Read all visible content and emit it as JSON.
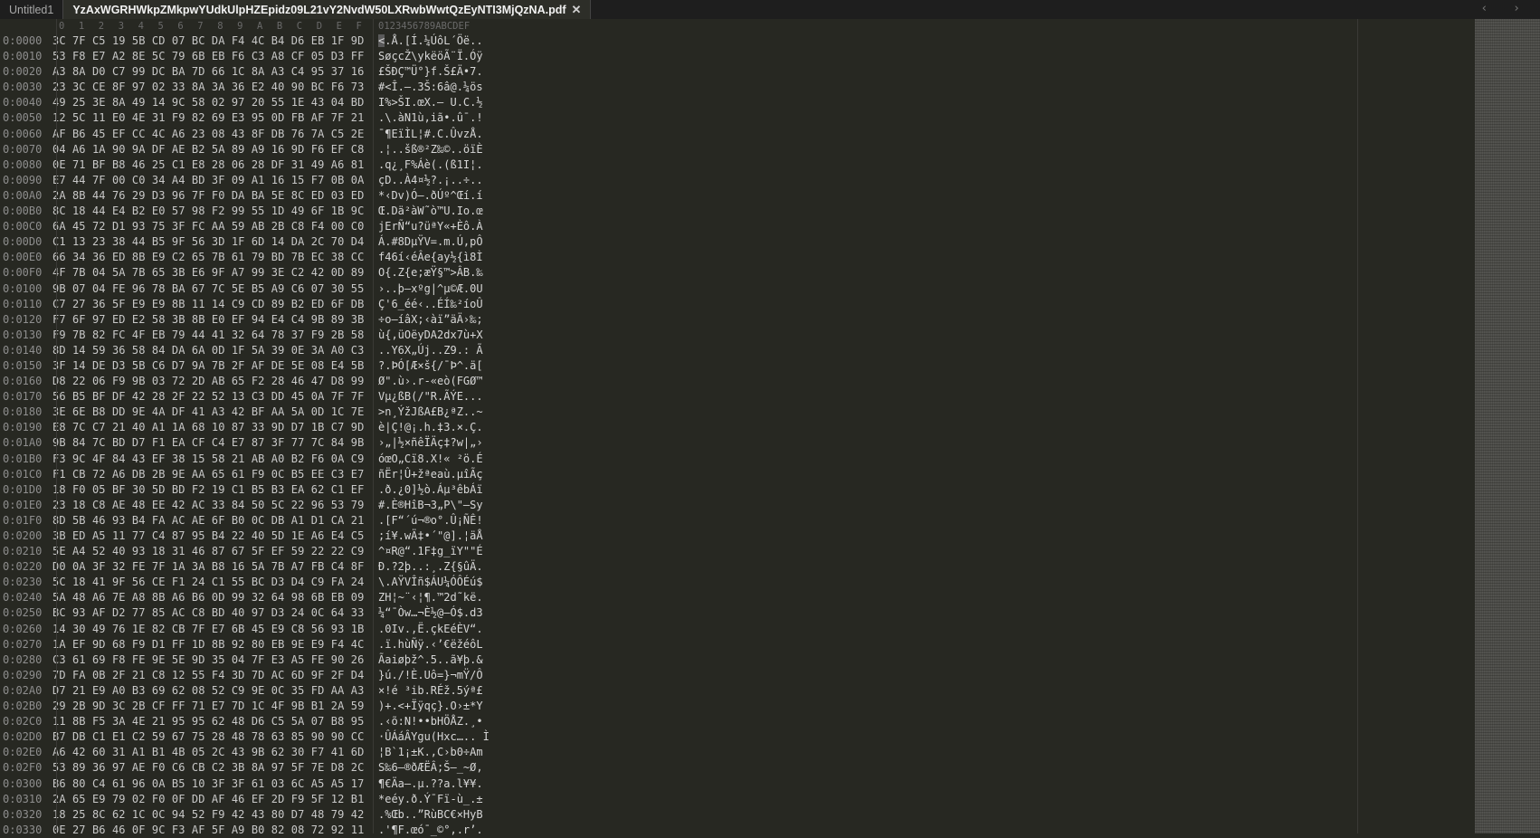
{
  "tabs": [
    {
      "label": "Untitled1",
      "active": false
    },
    {
      "label": "YzAxWGRHWkpZMkpwYUdkUlpHZEpidz09L21vY2NvdW50LXRwbWwtQzEyNTI3MjQzNA.pdf",
      "active": true
    }
  ],
  "tab_close_glyph": "✕",
  "tab_nav_glyphs": "‹ ›",
  "column_header": {
    "hex": [
      "0",
      "1",
      "2",
      "3",
      "4",
      "5",
      "6",
      "7",
      "8",
      "9",
      "A",
      "B",
      "C",
      "D",
      "E",
      "F"
    ],
    "ascii": "0123456789ABCDEF"
  },
  "rows": [
    {
      "addr": "0:0000",
      "hex": "3C 7F C5 19 5B CD 07 BC DA F4 4C B4 D6 EB 1F 9D",
      "ascii": "<.Å.[Í.¼ÚôL´Öë.."
    },
    {
      "addr": "0:0010",
      "hex": "53 F8 E7 A2 8E 5C 79 6B EB F6 C3 A8 CF 05 D3 FF",
      "ascii": "SøçcŽ\\ykëöÃ¨Ï.Óÿ"
    },
    {
      "addr": "0:0020",
      "hex": "A3 8A D0 C7 99 DC BA 7D 66 1C 8A A3 C4 95 37 16",
      "ascii": "£ŠÐÇ™Ü°}f.Š£Ä•7."
    },
    {
      "addr": "0:0030",
      "hex": "23 3C CE 8F 97 02 33 8A 3A 36 E2 40 90 BC F6 73",
      "ascii": "#<Î.—.3Š:6â@.¼ös"
    },
    {
      "addr": "0:0040",
      "hex": "49 25 3E 8A 49 14 9C 58 02 97 20 55 1E 43 04 BD",
      "ascii": "I%>ŠI.œX.— U.C.½"
    },
    {
      "addr": "0:0050",
      "hex": "12 5C 11 E0 4E 31 F9 82 69 E3 95 0D FB AF 7F 21",
      "ascii": ".\\.àN1ù‚iã•.û¯.!"
    },
    {
      "addr": "0:0060",
      "hex": "AF B6 45 EF CC 4C A6 23 08 43 8F DB 76 7A C5 2E",
      "ascii": "¯¶EïÌL¦#.C.ÛvzÅ."
    },
    {
      "addr": "0:0070",
      "hex": "04 A6 1A 90 9A DF AE B2 5A 89 A9 16 9D F6 EF C8",
      "ascii": ".¦..šß®²Z‰©..öïÈ"
    },
    {
      "addr": "0:0080",
      "hex": "0E 71 BF B8 46 25 C1 E8 28 06 28 DF 31 49 A6 81",
      "ascii": ".q¿¸F%Áè(.(ß1I¦."
    },
    {
      "addr": "0:0090",
      "hex": "E7 44 7F 00 C0 34 A4 BD 3F 09 A1 16 15 F7 0B 0A",
      "ascii": "çD..À4¤½?.¡..÷.."
    },
    {
      "addr": "0:00A0",
      "hex": "2A 8B 44 76 29 D3 96 7F F0 DA BA 5E 8C ED 03 ED",
      "ascii": "*‹Dv)Ó–.ðÚº^Œí.í"
    },
    {
      "addr": "0:00B0",
      "hex": "8C 18 44 E4 B2 E0 57 98 F2 99 55 1D 49 6F 1B 9C",
      "ascii": "Œ.Dä²àW˜ò™U.Io.œ"
    },
    {
      "addr": "0:00C0",
      "hex": "6A 45 72 D1 93 75 3F FC AA 59 AB 2B C8 F4 00 C0",
      "ascii": "jErÑ“u?üªY«+Èô.À"
    },
    {
      "addr": "0:00D0",
      "hex": "C1 13 23 38 44 B5 9F 56 3D 1F 6D 14 DA 2C 70 D4",
      "ascii": "Á.#8DµŸV=.m.Ú,pÔ"
    },
    {
      "addr": "0:00E0",
      "hex": "66 34 36 ED 8B E9 C2 65 7B 61 79 BD 7B EC 38 CC",
      "ascii": "f46í‹éÂe{ay½{ì8Ì"
    },
    {
      "addr": "0:00F0",
      "hex": "4F 7B 04 5A 7B 65 3B E6 9F A7 99 3E C2 42 0D 89",
      "ascii": "O{.Z{e;æŸ§™>ÂB.‰"
    },
    {
      "addr": "0:0100",
      "hex": "9B 07 04 FE 96 78 BA 67 7C 5E B5 A9 C6 07 30 55",
      "ascii": "›..þ–xºg|^µ©Æ.0U"
    },
    {
      "addr": "0:0110",
      "hex": "C7 27 36 5F E9 E9 8B 11 14 C9 CD 89 B2 ED 6F DB",
      "ascii": "Ç'6_éé‹..ÉÍ‰²íoÛ"
    },
    {
      "addr": "0:0120",
      "hex": "F7 6F 97 ED E2 58 3B 8B E0 EF 94 E4 C4 9B 89 3B",
      "ascii": "÷o—íâX;‹àï”äÄ›‰;"
    },
    {
      "addr": "0:0130",
      "hex": "F9 7B 82 FC 4F EB 79 44 41 32 64 78 37 F9 2B 58",
      "ascii": "ù{‚üOëyDA2dx7ù+X"
    },
    {
      "addr": "0:0140",
      "hex": "8D 14 59 36 58 84 DA 6A 0D 1F 5A 39 0E 3A A0 C3",
      "ascii": "..Y6X„Új..Z9.: Ã"
    },
    {
      "addr": "0:0150",
      "hex": "3F 14 DE D3 5B C6 D7 9A 7B 2F AF DE 5E 08 E4 5B",
      "ascii": "?.ÞÓ[Æ×š{/¯Þ^.ä["
    },
    {
      "addr": "0:0160",
      "hex": "D8 22 06 F9 9B 03 72 2D AB 65 F2 28 46 47 D8 99",
      "ascii": "Ø\".ù›.r-«eò(FGØ™"
    },
    {
      "addr": "0:0170",
      "hex": "56 B5 BF DF 42 28 2F 22 52 13 C3 DD 45 0A 7F 7F",
      "ascii": "Vµ¿ßB(/\"R.ÃÝE..."
    },
    {
      "addr": "0:0180",
      "hex": "3E 6E B8 DD 9E 4A DF 41 A3 42 BF AA 5A 0D 1C 7E",
      "ascii": ">n¸ÝžJßA£B¿ªZ..~"
    },
    {
      "addr": "0:0190",
      "hex": "E8 7C C7 21 40 A1 1A 68 10 87 33 9D D7 1B C7 9D",
      "ascii": "è|Ç!@¡.h.‡3.×.Ç."
    },
    {
      "addr": "0:01A0",
      "hex": "9B 84 7C BD D7 F1 EA CF C4 E7 87 3F 77 7C 84 9B",
      "ascii": "›„|½×ñêÏÄç‡?w|„›"
    },
    {
      "addr": "0:01B0",
      "hex": "F3 9C 4F 84 43 EF 38 15 58 21 AB A0 B2 F6 0A C9",
      "ascii": "óœO„Cï8.X!« ²ö.É"
    },
    {
      "addr": "0:01C0",
      "hex": "F1 CB 72 A6 DB 2B 9E AA 65 61 F9 0C B5 EE C3 E7",
      "ascii": "ñËr¦Û+žªeaù.µîÃç"
    },
    {
      "addr": "0:01D0",
      "hex": "18 F0 05 BF 30 5D BD F2 19 C1 B5 B3 EA 62 C1 EF",
      "ascii": ".ð.¿0]½ò.Áµ³êbÁï"
    },
    {
      "addr": "0:01E0",
      "hex": "23 18 C8 AE 48 EE 42 AC 33 84 50 5C 22 96 53 79",
      "ascii": "#.È®HîB¬3„P\\\"–Sy"
    },
    {
      "addr": "0:01F0",
      "hex": "8D 5B 46 93 B4 FA AC AE 6F B0 0C DB A1 D1 CA 21",
      "ascii": ".[F“´ú¬®o°.Û¡ÑÊ!"
    },
    {
      "addr": "0:0200",
      "hex": "3B ED A5 11 77 C4 87 95 B4 22 40 5D 1E A6 E4 C5",
      "ascii": ";í¥.wÄ‡•´\"@].¦äÅ"
    },
    {
      "addr": "0:0210",
      "hex": "5E A4 52 40 93 18 31 46 87 67 5F EF 59 22 22 C9",
      "ascii": "^¤R@“.1F‡g_ïY\"\"É"
    },
    {
      "addr": "0:0220",
      "hex": "D0 0A 3F 32 FE 7F 1A 3A B8 16 5A 7B A7 FB C4 8F",
      "ascii": "Ð.?2þ..:¸.Z{§ûÄ."
    },
    {
      "addr": "0:0230",
      "hex": "5C 18 41 9F 56 CE F1 24 C1 55 BC D3 D4 C9 FA 24",
      "ascii": "\\.AŸVÎñ$ÁU¼ÓÔÉú$"
    },
    {
      "addr": "0:0240",
      "hex": "5A 48 A6 7E A8 8B A6 B6 0D 99 32 64 98 6B EB 09",
      "ascii": "ZH¦~¨‹¦¶.™2d˜kë."
    },
    {
      "addr": "0:0250",
      "hex": "BC 93 AF D2 77 85 AC C8 BD 40 97 D3 24 0C 64 33",
      "ascii": "¼“¯Òw…¬È½@—Ó$.d3"
    },
    {
      "addr": "0:0260",
      "hex": "14 30 49 76 1E 82 CB 7F E7 6B 45 E9 C8 56 93 1B",
      "ascii": ".0Iv.‚Ë.çkEéÈV“."
    },
    {
      "addr": "0:0270",
      "hex": "1A EF 9D 68 F9 D1 FF 1D 8B 92 80 EB 9E E9 F4 4C",
      "ascii": ".ï.hùÑÿ.‹’€ëžéôL"
    },
    {
      "addr": "0:0280",
      "hex": "C3 61 69 F8 FE 9E 5E 9D 35 04 7F E3 A5 FE 90 26",
      "ascii": "Ãaiøþž^.5..ã¥þ.&"
    },
    {
      "addr": "0:0290",
      "hex": "7D FA 0B 2F 21 C8 12 55 F4 3D 7D AC 6D 9F 2F D4",
      "ascii": "}ú./!È.Uô=}¬mŸ/Ô"
    },
    {
      "addr": "0:02A0",
      "hex": "D7 21 E9 A0 B3 69 62 08 52 C9 9E 0C 35 FD AA A3",
      "ascii": "×!é ³ib.RÉž.5ýª£"
    },
    {
      "addr": "0:02B0",
      "hex": "29 2B 9D 3C 2B CF FF 71 E7 7D 1C 4F 9B B1 2A 59",
      "ascii": ")+.<+Ïÿqç}.O›±*Y"
    },
    {
      "addr": "0:02C0",
      "hex": "11 8B F5 3A 4E 21 95 95 62 48 D6 C5 5A 07 B8 95",
      "ascii": ".‹õ:N!••bHÖÅZ.¸•"
    },
    {
      "addr": "0:02D0",
      "hex": "B7 DB C1 E1 C2 59 67 75 28 48 78 63 85 90 90 CC",
      "ascii": "·ÛÁáÂYgu(Hxc….. Ì"
    },
    {
      "addr": "0:02E0",
      "hex": "A6 42 60 31 A1 B1 4B 05 2C 43 9B 62 30 F7 41 6D",
      "ascii": "¦B`1¡±K.,C›b0÷Am"
    },
    {
      "addr": "0:02F0",
      "hex": "53 89 36 97 AE F0 C6 CB C2 3B 8A 97 5F 7E D8 2C",
      "ascii": "S‰6—®ðÆËÂ;Š—_~Ø,"
    },
    {
      "addr": "0:0300",
      "hex": "B6 80 C4 61 96 0A B5 10 3F 3F 61 03 6C A5 A5 17",
      "ascii": "¶€Äa–.µ.??a.l¥¥."
    },
    {
      "addr": "0:0310",
      "hex": "2A 65 E9 79 02 F0 0F DD AF 46 EF 2D F9 5F 12 B1",
      "ascii": "*eéy.ð.Ý¯Fï-ù_.±"
    },
    {
      "addr": "0:0320",
      "hex": "18 25 8C 62 1C 0C 94 52 F9 42 43 80 D7 48 79 42",
      "ascii": ".%Œb..”RùBC€×HyB"
    },
    {
      "addr": "0:0330",
      "hex": "0E 27 B6 46 0F 9C F3 AF 5F A9 B0 82 08 72 92 11",
      "ascii": ".'¶F.œó¯_©°‚.r’."
    }
  ]
}
